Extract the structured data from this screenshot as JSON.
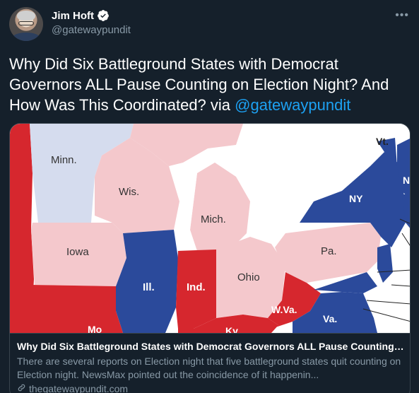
{
  "author": {
    "display_name": "Jim Hoft",
    "handle": "@gatewaypundit",
    "verified": true
  },
  "tweet": {
    "text_main": "Why Did Six Battleground States with Democrat Governors ALL Pause Counting on Election Night? And How Was This Coordinated? via ",
    "mention": "@gatewaypundit"
  },
  "card": {
    "title": "Why Did Six Battleground States with Democrat Governors ALL Pause Counting ...",
    "description": "There are several reports on Election night that five battleground states quit counting on Election night. NewsMax pointed out the coincidence of it happenin...",
    "domain": "thegatewaypundit.com"
  },
  "map": {
    "labels": {
      "minn": "Minn.",
      "wis": "Wis.",
      "mich": "Mich.",
      "iowa": "Iowa",
      "ill": "Ill.",
      "ind": "Ind.",
      "ohio": "Ohio",
      "pa": "Pa.",
      "ny": "NY",
      "vt": "Vt.",
      "nh": "N",
      "wva": "W.Va.",
      "va": "Va.",
      "mo": "Mo",
      "ky": "Ky"
    },
    "colors": {
      "dem_dark": "#2b4a9b",
      "rep_dark": "#d6272e",
      "rep_light": "#f4c8cc",
      "dem_light": "#d5dcee",
      "lake": "#ffffff"
    }
  },
  "icons": {
    "verified": "verified-badge-icon",
    "more": "more-options-icon",
    "link": "link-icon"
  }
}
